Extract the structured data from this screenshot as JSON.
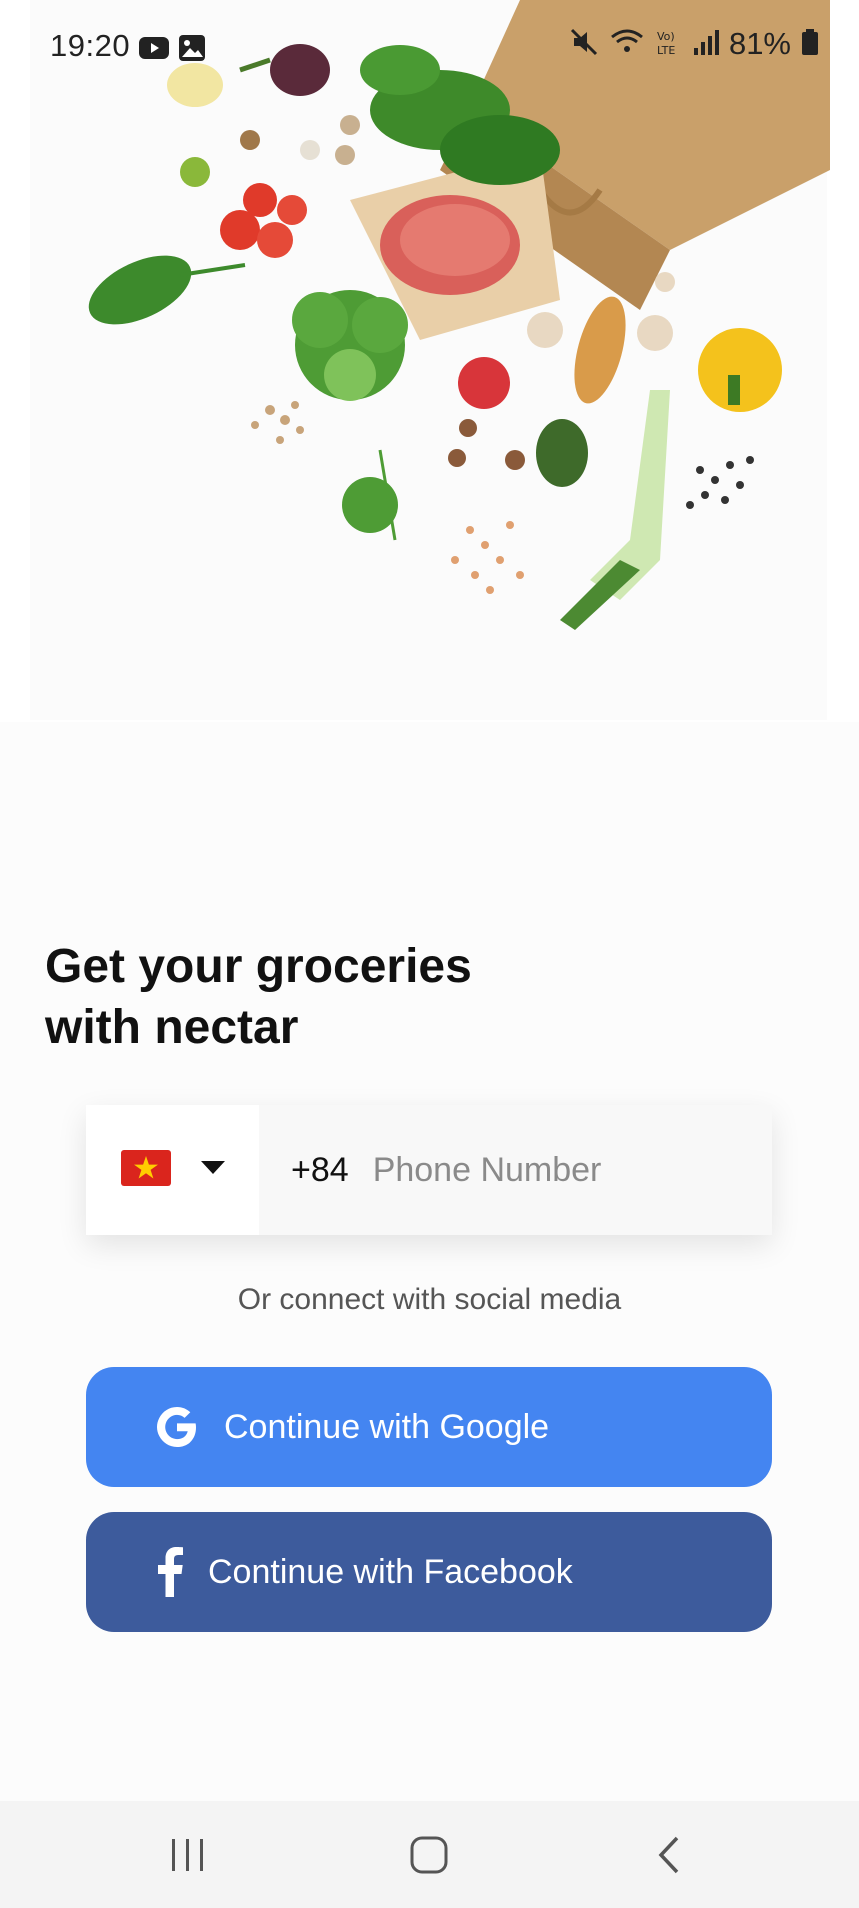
{
  "status_bar": {
    "time": "19:20",
    "battery": "81%",
    "icons": [
      "youtube-icon",
      "gallery-icon",
      "mute-icon",
      "wifi-icon",
      "volte-icon",
      "signal-icon",
      "battery-icon"
    ]
  },
  "onboarding": {
    "title": "Get your groceries\nwith nectar",
    "country_flag": "vietnam-flag-icon",
    "dial_code": "+84",
    "phone_placeholder": "Phone Number",
    "social_text": "Or connect with social media",
    "google_label": "Continue with Google",
    "facebook_label": "Continue with Facebook"
  },
  "colors": {
    "google": "#4485f1",
    "facebook": "#3d5b9c",
    "background": "#fcfcfc"
  },
  "nav": {
    "icons": [
      "recent-apps-icon",
      "home-icon",
      "back-icon"
    ]
  }
}
